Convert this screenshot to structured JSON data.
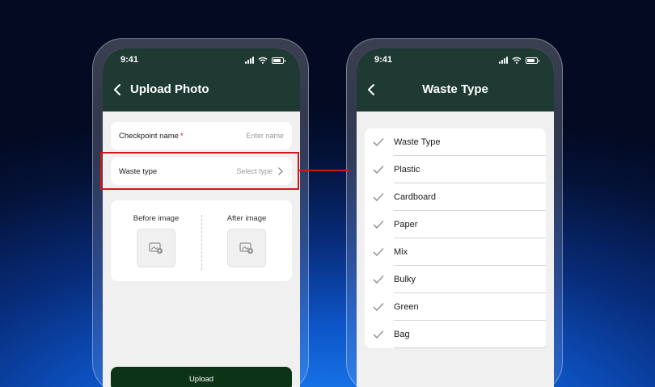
{
  "left_screen": {
    "status_time": "9:41",
    "title": "Upload Photo",
    "checkpoint": {
      "label": "Checkpoint name",
      "required_mark": "*",
      "placeholder": "Enter name"
    },
    "waste_type": {
      "label": "Waste type",
      "placeholder": "Select type"
    },
    "before_image_label": "Before image",
    "after_image_label": "After image",
    "upload_label": "Upload"
  },
  "right_screen": {
    "status_time": "9:41",
    "title": "Waste Type",
    "options": [
      "Waste Type",
      "Plastic",
      "Cardboard",
      "Paper",
      "Mix",
      "Bulky",
      "Green",
      "Bag"
    ]
  },
  "colors": {
    "appbar": "#1e3a32",
    "upload_button": "#0b3417",
    "highlight": "#d0171d",
    "check": "#9a9a9a"
  }
}
